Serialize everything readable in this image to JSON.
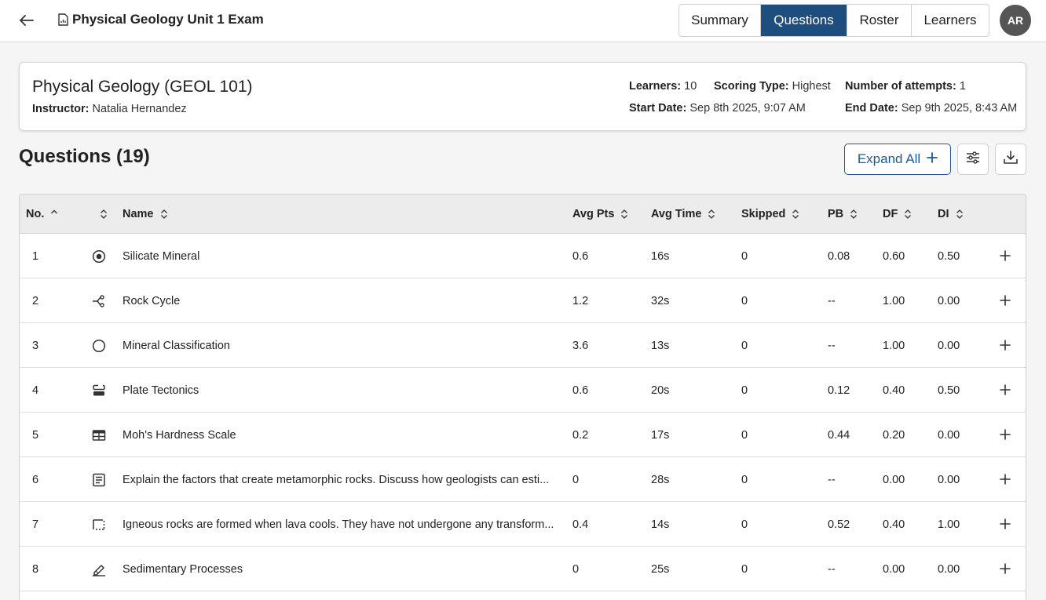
{
  "header": {
    "title": "Physical Geology Unit 1 Exam",
    "tabs": [
      "Summary",
      "Questions",
      "Roster",
      "Learners"
    ],
    "active_tab": "Questions",
    "avatar_initials": "AR"
  },
  "course": {
    "name": "Physical Geology (GEOL 101)",
    "instructor_label": "Instructor:",
    "instructor": "Natalia Hernandez",
    "learners_label": "Learners:",
    "learners": "10",
    "scoring_label": "Scoring Type:",
    "scoring": "Highest",
    "attempts_label": "Number of attempts:",
    "attempts": "1",
    "start_label": "Start Date:",
    "start": "Sep 8th 2025, 9:07 AM",
    "end_label": "End Date:",
    "end": "Sep 9th 2025, 8:43 AM"
  },
  "questions": {
    "title": "Questions (19)",
    "expand_all_label": "Expand All",
    "columns": [
      "No.",
      "",
      "Name",
      "Avg Pts",
      "Avg Time",
      "Skipped",
      "PB",
      "DF",
      "DI"
    ],
    "rows": [
      {
        "no": "1",
        "icon": "radio-icon",
        "name": "Silicate Mineral",
        "avg_pts": "0.6",
        "avg_time": "16s",
        "skipped": "0",
        "pb": "0.08",
        "df": "0.60",
        "di": "0.50"
      },
      {
        "no": "2",
        "icon": "matching-icon",
        "name": "Rock Cycle",
        "avg_pts": "1.2",
        "avg_time": "32s",
        "skipped": "0",
        "pb": "--",
        "df": "1.00",
        "di": "0.00"
      },
      {
        "no": "3",
        "icon": "circle-icon",
        "name": "Mineral Classification",
        "avg_pts": "3.6",
        "avg_time": "13s",
        "skipped": "0",
        "pb": "--",
        "df": "1.00",
        "di": "0.00"
      },
      {
        "no": "4",
        "icon": "ordering-icon",
        "name": "Plate Tectonics",
        "avg_pts": "0.6",
        "avg_time": "20s",
        "skipped": "0",
        "pb": "0.12",
        "df": "0.40",
        "di": "0.50"
      },
      {
        "no": "5",
        "icon": "table-icon",
        "name": "Moh's Hardness Scale",
        "avg_pts": "0.2",
        "avg_time": "17s",
        "skipped": "0",
        "pb": "0.44",
        "df": "0.20",
        "di": "0.00"
      },
      {
        "no": "6",
        "icon": "essay-icon",
        "name": "Explain the factors that create metamorphic rocks. Discuss how geologists can esti...",
        "avg_pts": "0",
        "avg_time": "28s",
        "skipped": "0",
        "pb": "--",
        "df": "0.00",
        "di": "0.00"
      },
      {
        "no": "7",
        "icon": "fill-blank-icon",
        "name": "Igneous rocks are formed when lava cools. They have not undergone any transform...",
        "avg_pts": "0.4",
        "avg_time": "14s",
        "skipped": "0",
        "pb": "0.52",
        "df": "0.40",
        "di": "1.00"
      },
      {
        "no": "8",
        "icon": "drawing-icon",
        "name": "Sedimentary Processes",
        "avg_pts": "0",
        "avg_time": "25s",
        "skipped": "0",
        "pb": "--",
        "df": "0.00",
        "di": "0.00"
      }
    ]
  },
  "colors": {
    "active_tab": "#1d4e7e",
    "accent": "#1d5a94",
    "avatar": "#555555",
    "header_row": "#ececec"
  }
}
